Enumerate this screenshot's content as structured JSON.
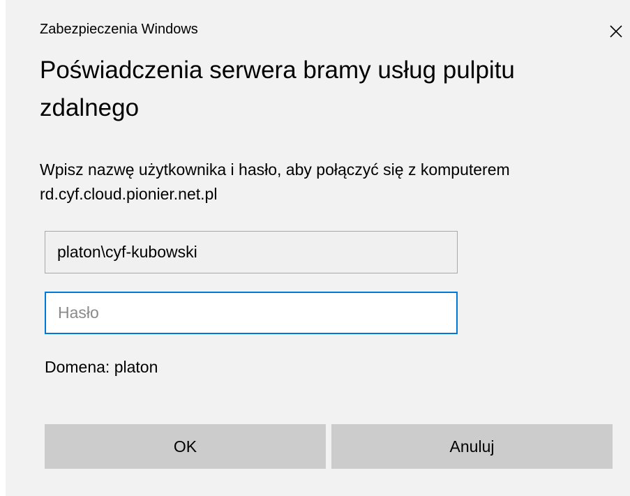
{
  "dialog": {
    "caption": "Zabezpieczenia Windows",
    "title": "Poświadczenia serwera bramy usług pulpitu zdalnego",
    "description": "Wpisz nazwę użytkownika i hasło, aby połączyć się z komputerem rd.cyf.cloud.pionier.net.pl",
    "username_value": "platon\\cyf-kubowski",
    "password_placeholder": "Hasło",
    "domain_text": "Domena: platon",
    "ok_label": "OK",
    "cancel_label": "Anuluj",
    "close_icon": "close-icon"
  },
  "colors": {
    "dialog_background": "#f2f2f2",
    "focus_border": "#0078d7",
    "button_background": "#cccccc"
  }
}
